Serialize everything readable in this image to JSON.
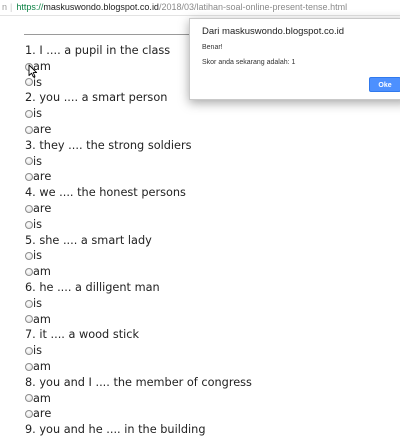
{
  "address_bar": {
    "prefix": "n",
    "scheme": "https://",
    "host": "maskuswondo.blogspot.co.id",
    "path": "/2018/03/latihan-soal-online-present-tense.html"
  },
  "quiz": {
    "questions": [
      {
        "text": "1. I .... a pupil in the class",
        "options": [
          "am",
          "is"
        ]
      },
      {
        "text": "2. you .... a smart person",
        "options": [
          "is",
          "are"
        ]
      },
      {
        "text": "3. they .... the strong soldiers",
        "options": [
          "is",
          "are"
        ]
      },
      {
        "text": "4. we .... the honest persons",
        "options": [
          "are",
          "is"
        ]
      },
      {
        "text": "5. she .... a smart lady",
        "options": [
          "is",
          "am"
        ]
      },
      {
        "text": "6. he .... a dilligent man",
        "options": [
          "is",
          "am"
        ]
      },
      {
        "text": "7. it .... a wood stick",
        "options": [
          "is",
          "am"
        ]
      },
      {
        "text": "8. you and I .... the member of congress",
        "options": [
          "am",
          "are"
        ]
      },
      {
        "text": "9. you and he .... in the building",
        "options": []
      }
    ]
  },
  "dialog": {
    "title": "Dari maskuswondo.blogspot.co.id",
    "message": "Benar!",
    "score_text": "Skor anda sekarang adalah: 1",
    "ok_label": "Oke",
    "ok_color": "#4d90fe"
  }
}
